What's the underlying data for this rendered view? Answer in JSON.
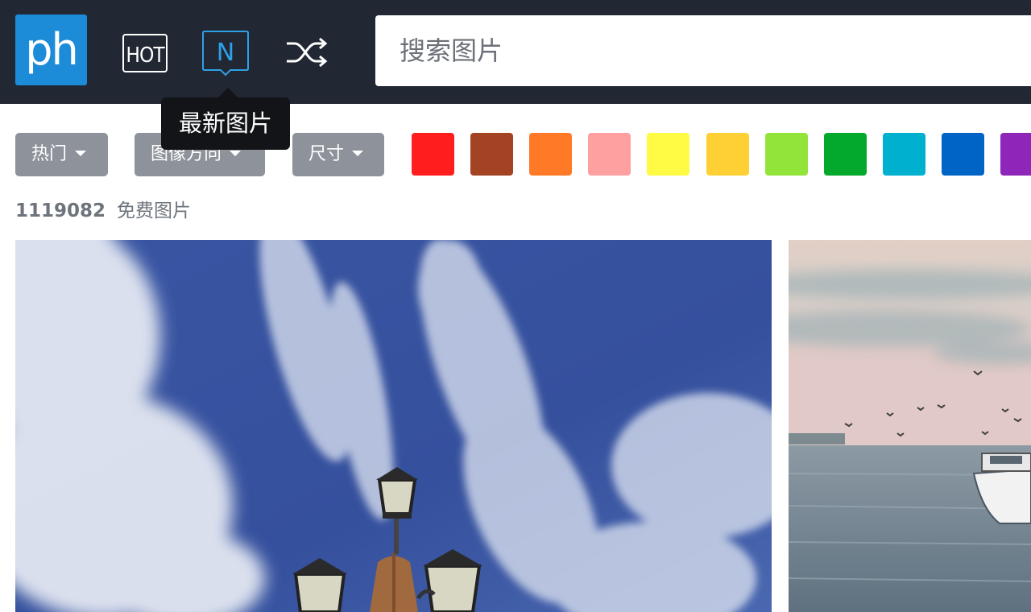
{
  "header": {
    "logo_text": "ph",
    "nav_icons": [
      "hot-icon",
      "new-icon",
      "shuffle-icon"
    ],
    "search": {
      "placeholder": "搜索图片",
      "value": ""
    },
    "tooltip": "最新图片"
  },
  "filters": {
    "hot_label": "热门",
    "orientation_label": "图像方向",
    "size_label": "尺寸"
  },
  "color_swatches": [
    "#ff1d1d",
    "#a34323",
    "#ff7926",
    "#ffa0a0",
    "#fffa44",
    "#ffd033",
    "#93e43a",
    "#03a92c",
    "#00b0cf",
    "#0063c6",
    "#8e26b9"
  ],
  "results": {
    "count": "1119082",
    "label": "免费图片"
  },
  "colors": {
    "header_bg": "#212733",
    "logo_bg": "#1c8cd8",
    "active_icon": "#2ea0e6",
    "filter_bg": "#8e939b"
  }
}
